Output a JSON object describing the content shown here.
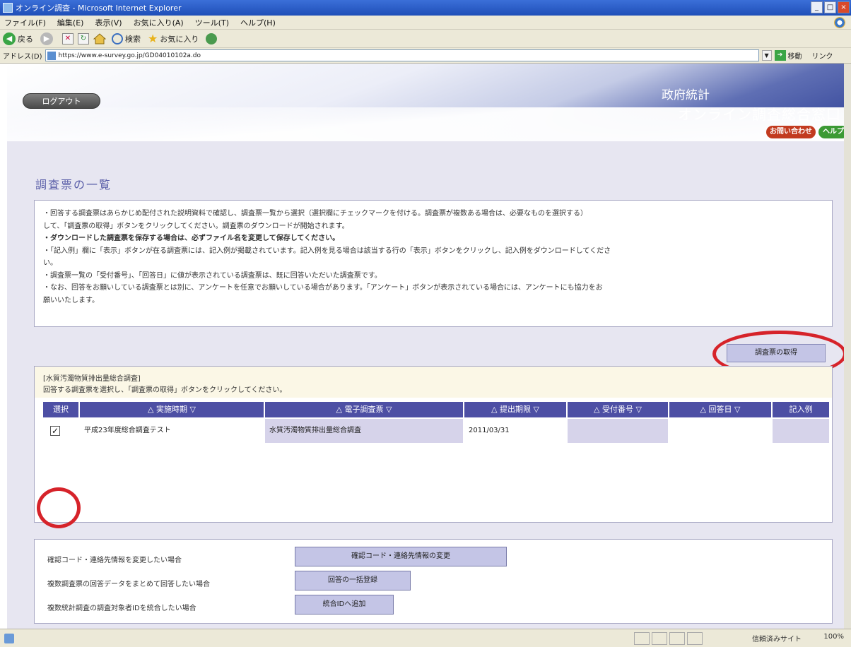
{
  "window": {
    "title": "オンライン調査 - Microsoft Internet Explorer",
    "minimize_label": "_",
    "maximize_label": "□",
    "close_label": "×"
  },
  "menubar": {
    "items": [
      "ファイル(F)",
      "編集(E)",
      "表示(V)",
      "お気に入り(A)",
      "ツール(T)",
      "ヘルプ(H)"
    ]
  },
  "toolbar": {
    "back_label": "戻る",
    "search_label": "検索",
    "favorites_label": "お気に入り"
  },
  "addressbar": {
    "label": "アドレス(D)",
    "url": "https://www.e-survey.go.jp/GD04010102a.do",
    "go_label": "移動",
    "links_label": "リンク"
  },
  "banner": {
    "logout_label": "ログアウト",
    "site_title_line1": "政府統計",
    "site_title_line2": "オンライン調査総合窓口",
    "contact_label": "お問い合わせ",
    "help_label": "ヘルプ"
  },
  "page": {
    "heading": "調査票の一覧",
    "instructions": [
      "・回答する調査票はあらかじめ配付された説明資料で確認し、調査票一覧から選択（選択欄にチェックマークを付ける。調査票が複数ある場合は、必要なものを選択する）",
      "して、「調査票の取得」ボタンをクリックしてください。調査票のダウンロードが開始されます。",
      "・ダウンロードした調査票を保存する場合は、必ずファイル名を変更して保存してください。",
      "・「記入例」欄に「表示」ボタンが在る調査票には、記入例が掲載されています。記入例を見る場合は該当する行の「表示」ボタンをクリックし、記入例をダウンロードしてくださ",
      "い。",
      "・調査票一覧の「受付番号」、「回答日」に値が表示されている調査票は、既に回答いただいた調査票です。",
      "・なお、回答をお願いしている調査票とは別に、アンケートを任意でお願いしている場合があります。「アンケート」ボタンが表示されている場合には、アンケートにも協力をお",
      "願いいたします。"
    ],
    "get_survey_button": "調査票の取得"
  },
  "survey": {
    "name": "[水質汚濁物質排出量総合調査]",
    "instruction": "回答する調査票を選択し、「調査票の取得」ボタンをクリックしてください。",
    "columns": [
      "選択",
      "△ 実施時期 ▽",
      "△ 電子調査票 ▽",
      "△ 提出期限 ▽",
      "△ 受付番号 ▽",
      "△ 回答日 ▽",
      "記入例"
    ],
    "rows": [
      {
        "checked": "✓",
        "period": "平成23年度総合調査テスト",
        "form": "水質汚濁物質排出量総合調査",
        "deadline": "2011/03/31",
        "receipt_no": "",
        "answer_date": "",
        "example": ""
      }
    ]
  },
  "actions": [
    {
      "label": "確認コード・連絡先情報を変更したい場合",
      "button": "確認コード・連絡先情報の変更"
    },
    {
      "label": "複数調査票の回答データをまとめて回答したい場合",
      "button": "回答の一括登録"
    },
    {
      "label": "複数統計調査の調査対象者IDを統合したい場合",
      "button": "統合IDへ追加"
    }
  ],
  "statusbar": {
    "zone": "信頼済みサイト",
    "zoom": "100%"
  },
  "colors": {
    "header_blue": "#4d4fa4",
    "button_lavender": "#c4c5e6",
    "highlight_red": "#d6232a",
    "page_bg": "#e7e6f1"
  }
}
